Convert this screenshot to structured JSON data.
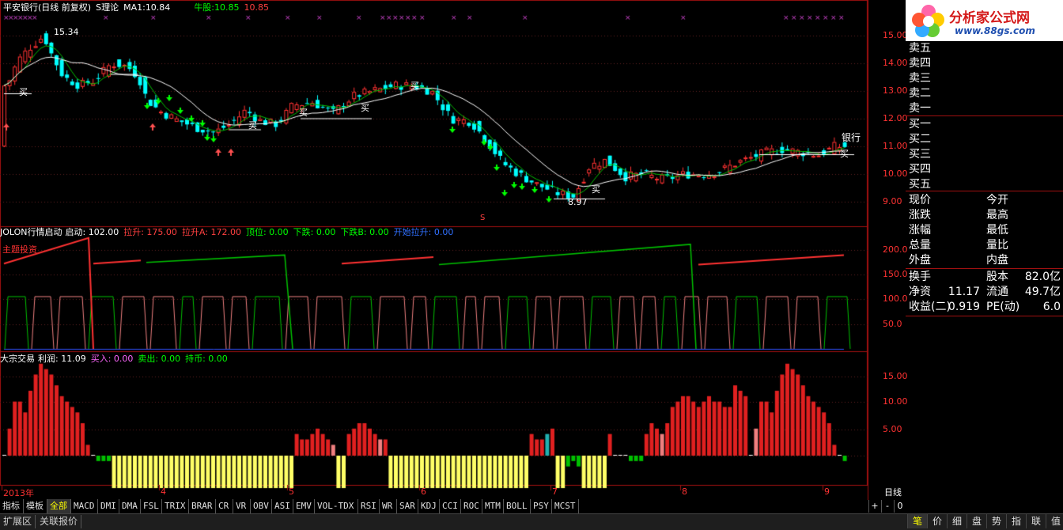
{
  "header": {
    "main": {
      "stock": "平安银行(日线 前复权)",
      "theory": "S理论",
      "ma1_label": "MA1:",
      "ma1": "10.84",
      "bull_label": "牛股:",
      "bull1": "10.85",
      "bull2": "10.85"
    },
    "ind1": {
      "name": "JOLON行情启动",
      "start": "启动: 102.00",
      "lift": "拉升: 175.00",
      "liftA": "拉升A: 172.00",
      "top": "顶位: 0.00",
      "down": "下跌: 0.00",
      "downB": "下跌B: 0.00",
      "begin": "开始拉升: 0.00"
    },
    "ind2": {
      "name": "大宗交易",
      "profit": "利润: 11.09",
      "buy": "买入: 0.00",
      "sell": "卖出: 0.00",
      "hold": "持币: 0.00"
    }
  },
  "annotations": {
    "high": "15.34",
    "low": "8.97",
    "bank": "银行",
    "buy_mark": "买",
    "s_mark": "S",
    "theme": "主题投资"
  },
  "axes": {
    "main": [
      "15.00",
      "14.00",
      "13.00",
      "12.00",
      "11.00",
      "10.00",
      "9.00"
    ],
    "ind1": [
      "200.0",
      "150.0",
      "100.0",
      "50.0"
    ],
    "ind2": [
      "15.00",
      "10.00",
      "5.00"
    ],
    "dates": [
      {
        "label": "2013年"
      },
      {
        "label": "4"
      },
      {
        "label": "5"
      },
      {
        "label": "6"
      },
      {
        "label": "7"
      },
      {
        "label": "8"
      },
      {
        "label": "9"
      }
    ],
    "period": "日线"
  },
  "orderbook": {
    "sell": [
      "卖五",
      "卖四",
      "卖三",
      "卖二",
      "卖一"
    ],
    "buy": [
      "买一",
      "买二",
      "买三",
      "买四",
      "买五"
    ]
  },
  "quote": {
    "left": [
      "现价",
      "涨跌",
      "涨幅",
      "总量",
      "外盘"
    ],
    "right": [
      "今开",
      "最高",
      "最低",
      "量比",
      "内盘"
    ]
  },
  "stats": [
    {
      "l": "换手",
      "lv": "",
      "r": "股本",
      "rv": "82.0亿"
    },
    {
      "l": "净资",
      "lv": "11.17",
      "r": "流通",
      "rv": "49.7亿"
    },
    {
      "l": "收益(二)",
      "lv": "0.919",
      "r": "PE(动)",
      "rv": "6.0"
    }
  ],
  "toolbar": [
    "指标",
    "模板",
    "全部",
    "MACD",
    "DMI",
    "DMA",
    "FSL",
    "TRIX",
    "BRAR",
    "CR",
    "VR",
    "OBV",
    "ASI",
    "EMV",
    "VOL-TDX",
    "RSI",
    "WR",
    "SAR",
    "KDJ",
    "CCI",
    "ROC",
    "MTM",
    "BOLL",
    "PSY",
    "MCST"
  ],
  "toolbar_right": [
    "+",
    "-",
    "0"
  ],
  "status_tabs": [
    "扩展区",
    "关联报价"
  ],
  "right_tabs": [
    "笔",
    "价",
    "细",
    "盘",
    "势",
    "指",
    "联",
    "值"
  ],
  "logo": {
    "text": "分析家公式网",
    "url": "www.88gs.com"
  },
  "colors": {
    "up": "#ff3232",
    "down": "#00ffff",
    "ma": "#ffffff",
    "bull": "#ffffff",
    "green": "#00c000",
    "yellow": "#ffff66",
    "pink": "#f08080"
  },
  "chart_data": [
    {
      "type": "candlestick",
      "title": "平安银行(日线 前复权)",
      "ylim": [
        8.6,
        15.5
      ],
      "ma1_last": 10.84,
      "high_label": 15.34,
      "low_label": 8.97
    },
    {
      "type": "line",
      "title": "JOLON行情启动",
      "ylim": [
        0,
        230
      ],
      "series": [
        {
          "name": "启动",
          "last": 102
        },
        {
          "name": "拉升",
          "last": 175
        },
        {
          "name": "拉升A",
          "last": 172
        }
      ]
    },
    {
      "type": "bar",
      "title": "大宗交易",
      "ylim": [
        -6,
        18
      ],
      "last": 11.09
    }
  ]
}
